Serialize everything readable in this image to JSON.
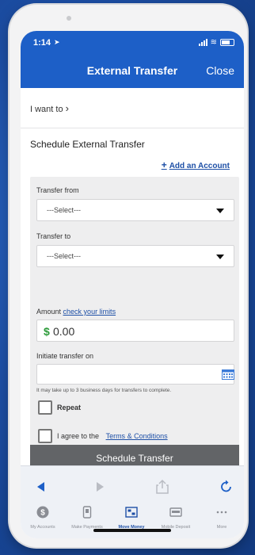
{
  "status": {
    "time": "1:14"
  },
  "header": {
    "title": "External Transfer",
    "close_label": "Close"
  },
  "iwant": {
    "label": "I want to"
  },
  "section": {
    "title": "Schedule External Transfer",
    "add_account_label": "Add an Account"
  },
  "form": {
    "transfer_from_label": "Transfer from",
    "transfer_from_value": "---Select---",
    "transfer_to_label": "Transfer to",
    "transfer_to_value": "---Select---",
    "amount_label": "Amount",
    "amount_link": "check your limits",
    "amount_prefix": "$",
    "amount_value": "0.00",
    "date_label": "Initiate transfer on",
    "date_value": "",
    "date_hint": "It may take up to 3 business days for transfers to complete.",
    "repeat_label": "Repeat",
    "agree_label": "I agree to the",
    "terms_link": "Terms & Conditions",
    "submit_label": "Schedule Transfer"
  },
  "tabs": [
    {
      "label": "My Accounts",
      "icon": "dollar-circle-icon"
    },
    {
      "label": "Make Payments",
      "icon": "payment-icon"
    },
    {
      "label": "Move Money",
      "icon": "move-money-icon"
    },
    {
      "label": "Mobile Deposit",
      "icon": "deposit-icon"
    },
    {
      "label": "More",
      "icon": "more-icon"
    }
  ],
  "colors": {
    "header": "#1d5fc7",
    "accent": "#1d4fa6",
    "amount_dollar": "#2d9b3a",
    "button": "#626467"
  }
}
